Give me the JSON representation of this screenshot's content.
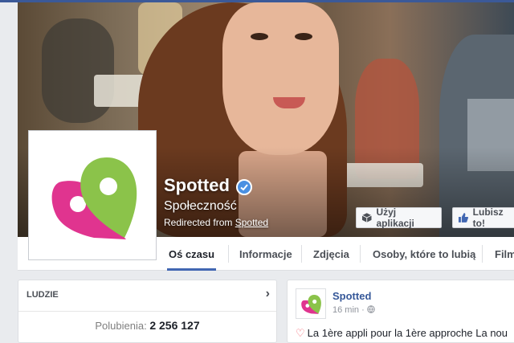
{
  "page": {
    "name": "Spotted",
    "category": "Społeczność",
    "redirected_prefix": "Redirected from",
    "redirected_link": "Spotted"
  },
  "buttons": {
    "use_app": "Użyj aplikacji",
    "like": "Lubisz to!"
  },
  "tabs": [
    {
      "label": "Oś czasu",
      "active": true
    },
    {
      "label": "Informacje",
      "active": false
    },
    {
      "label": "Zdjęcia",
      "active": false
    },
    {
      "label": "Osoby, które to lubią",
      "active": false
    },
    {
      "label": "Filmy",
      "active": false
    }
  ],
  "people_card": {
    "header": "LUDZIE",
    "likes_label": "Polubienia:",
    "likes_value": "2 256 127"
  },
  "post": {
    "author": "Spotted",
    "time": "16 min",
    "separator": "·",
    "text": "La 1ère appli pour la 1ère approche  La nou"
  },
  "colors": {
    "brand_blue": "#4267b2",
    "logo_green": "#8bc34a",
    "logo_pink": "#e0348f",
    "verified_blue": "#4a90e2"
  },
  "icons": [
    "verified-badge-icon",
    "cube-app-icon",
    "thumbs-up-icon",
    "chevron-right-icon",
    "globe-icon",
    "heart-emoji-icon"
  ]
}
